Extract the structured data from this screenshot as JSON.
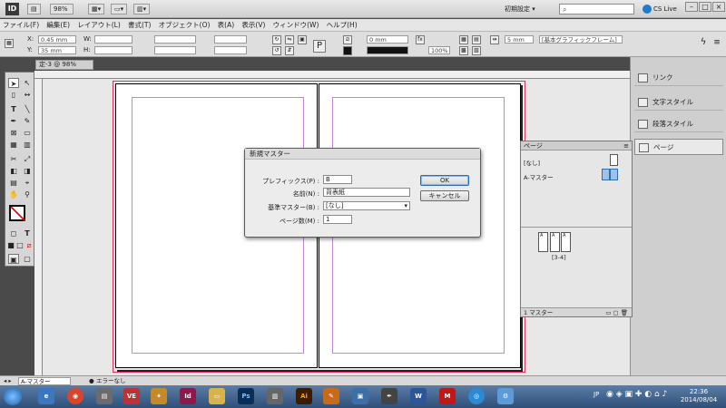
{
  "appbar": {
    "logo": "ID",
    "zoom": "98%",
    "workspace": "初期設定 ▾",
    "search_glyph": "⌕",
    "cs_live": "CS Live"
  },
  "menu": [
    "ファイル(F)",
    "編集(E)",
    "レイアウト(L)",
    "書式(T)",
    "オブジェクト(O)",
    "表(A)",
    "表示(V)",
    "ウィンドウ(W)",
    "ヘルプ(H)"
  ],
  "control": {
    "x_label": "X:",
    "x_value": "0.45 mm",
    "y_label": "Y:",
    "y_value": "35 mm",
    "w_label": "W:",
    "h_label": "H:",
    "stroke_value": "0 mm",
    "percent": "100%",
    "gap_value": "5 mm",
    "frame_style": "[基本グラフィックフレーム]"
  },
  "document_tab": "定-3 @ 98%",
  "pages_panel": {
    "title": "ページ",
    "none_label": "[なし]",
    "master_label": "A-マスター",
    "page_label": "[3-4]",
    "footer": "1 マスター",
    "thumb_labels": [
      "A",
      "A",
      "A"
    ]
  },
  "dock": {
    "items": [
      "リンク",
      "文字スタイル",
      "段落スタイル",
      "ページ"
    ]
  },
  "dialog": {
    "title": "新規マスター",
    "prefix_label": "プレフィックス(P) :",
    "prefix_value": "B",
    "name_label": "名前(N) :",
    "name_value": "背表紙",
    "base_label": "基準マスター(B) :",
    "base_value": "[なし]",
    "pages_label": "ページ数(M) :",
    "pages_value": "1",
    "ok": "OK",
    "cancel": "キャンセル"
  },
  "status": {
    "page": "A-マスター",
    "errors": "エラーなし"
  },
  "taskbar": {
    "clock_time": "22:36",
    "clock_date": "2014/08/04",
    "ime": "JP"
  }
}
